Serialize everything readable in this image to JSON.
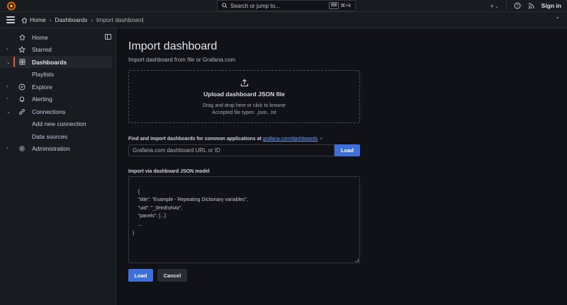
{
  "topbar": {
    "search_placeholder": "Search or jump to...",
    "shortcut_key": "⌘+k",
    "add_label": "+",
    "sign_in": "Sign in"
  },
  "breadcrumb": {
    "items": [
      "Home",
      "Dashboards",
      "Import dashboard"
    ]
  },
  "sidebar": {
    "items": [
      {
        "label": "Home"
      },
      {
        "label": "Starred"
      },
      {
        "label": "Dashboards"
      },
      {
        "label": "Playlists"
      },
      {
        "label": "Explore"
      },
      {
        "label": "Alerting"
      },
      {
        "label": "Connections"
      },
      {
        "label": "Add new connection"
      },
      {
        "label": "Data sources"
      },
      {
        "label": "Administration"
      }
    ]
  },
  "main": {
    "title": "Import dashboard",
    "subtitle": "Import dashboard from file or Grafana.com",
    "upload": {
      "title": "Upload dashboard JSON file",
      "hint": "Drag and drop here or click to browse",
      "types": "Accepted file types: .json, .txt"
    },
    "find": {
      "label": "Find and import dashboards for common applications at",
      "link": "grafana.com/dashboards",
      "placeholder": "Grafana.com dashboard URL or ID",
      "load": "Load"
    },
    "json": {
      "label": "Import via dashboard JSON model",
      "value": "{\n    \"title\": \"Example - Repeating Dictionary variables\",\n    \"uid\": \"_0HnEoN4z\",\n    \"panels\": [...]\n    ...\n}"
    },
    "actions": {
      "load": "Load",
      "cancel": "Cancel"
    }
  },
  "colors": {
    "accent": "#f05a28",
    "primary": "#3d71d9",
    "background": "#111217",
    "panel": "#181b1f"
  }
}
